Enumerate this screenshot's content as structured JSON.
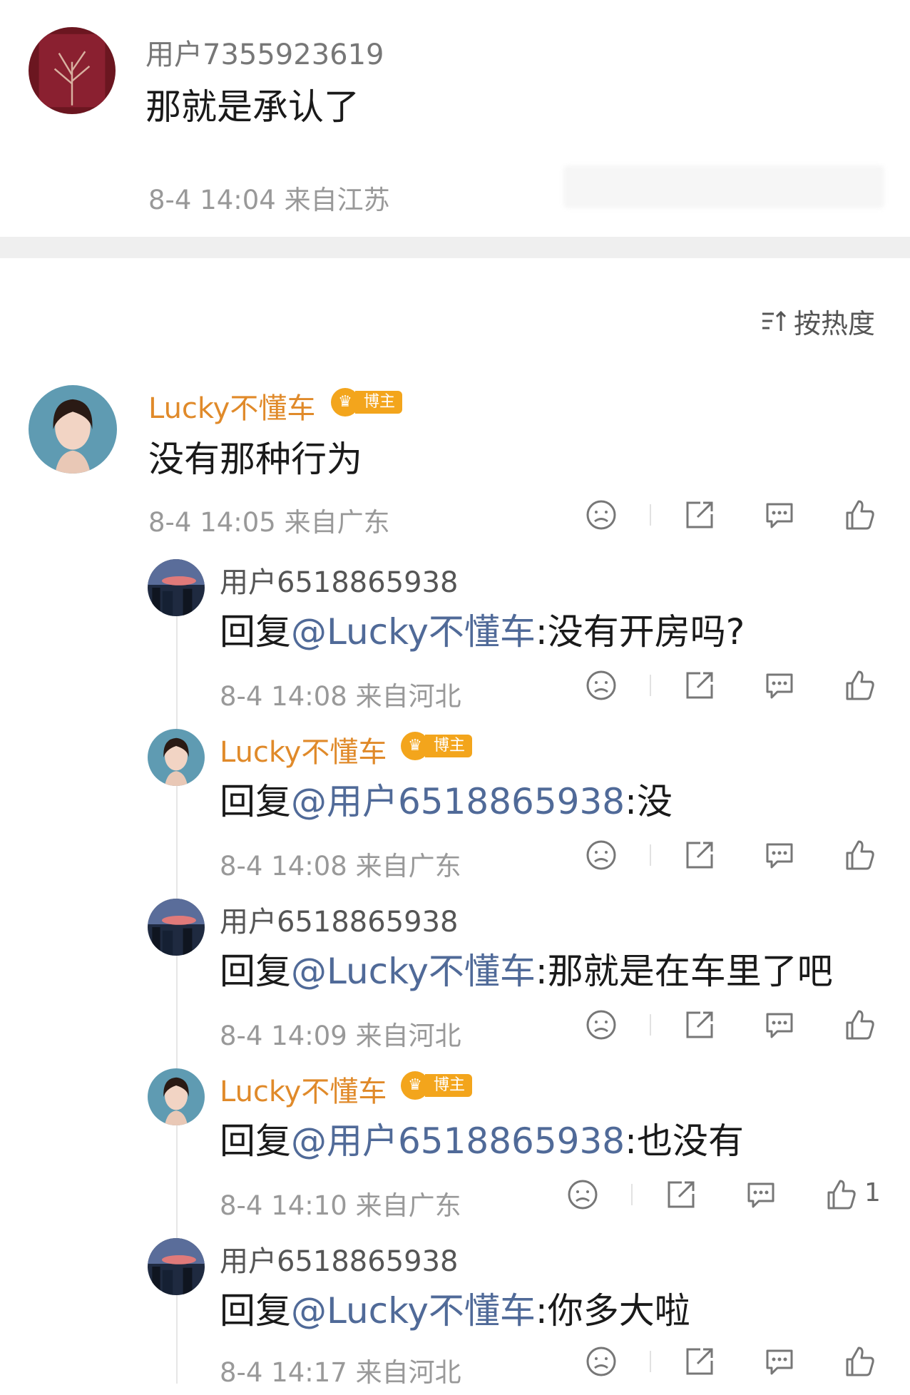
{
  "top_comment": {
    "username": "用户7355923619",
    "text": "那就是承认了",
    "meta": "8-4 14:04 来自江苏"
  },
  "sort": {
    "label": "按热度"
  },
  "main_comment": {
    "username": "Lucky不懂车",
    "badge": "博主",
    "text": "没有那种行为",
    "meta": "8-4 14:05 来自广东"
  },
  "replies": [
    {
      "username": "用户6518865938",
      "prefix": "回复",
      "mention": "@Lucky不懂车",
      "text": ":没有开房吗?",
      "meta": "8-4 14:08 来自河北"
    },
    {
      "username": "Lucky不懂车",
      "badge": "博主",
      "prefix": "回复",
      "mention": "@用户6518865938",
      "text": ":没",
      "meta": "8-4 14:08 来自广东"
    },
    {
      "username": "用户6518865938",
      "prefix": "回复",
      "mention": "@Lucky不懂车",
      "text": ":那就是在车里了吧",
      "meta": "8-4 14:09 来自河北"
    },
    {
      "username": "Lucky不懂车",
      "badge": "博主",
      "prefix": "回复",
      "mention": "@用户6518865938",
      "text": ":也没有",
      "meta": "8-4 14:10 来自广东",
      "like_count": "1"
    },
    {
      "username": "用户6518865938",
      "prefix": "回复",
      "mention": "@Lucky不懂车",
      "text": ":你多大啦",
      "meta": "8-4 14:17 来自河北"
    }
  ],
  "colors": {
    "blogger": "#e08a2a",
    "mention": "#506a98",
    "badge": "#f3a51c"
  }
}
